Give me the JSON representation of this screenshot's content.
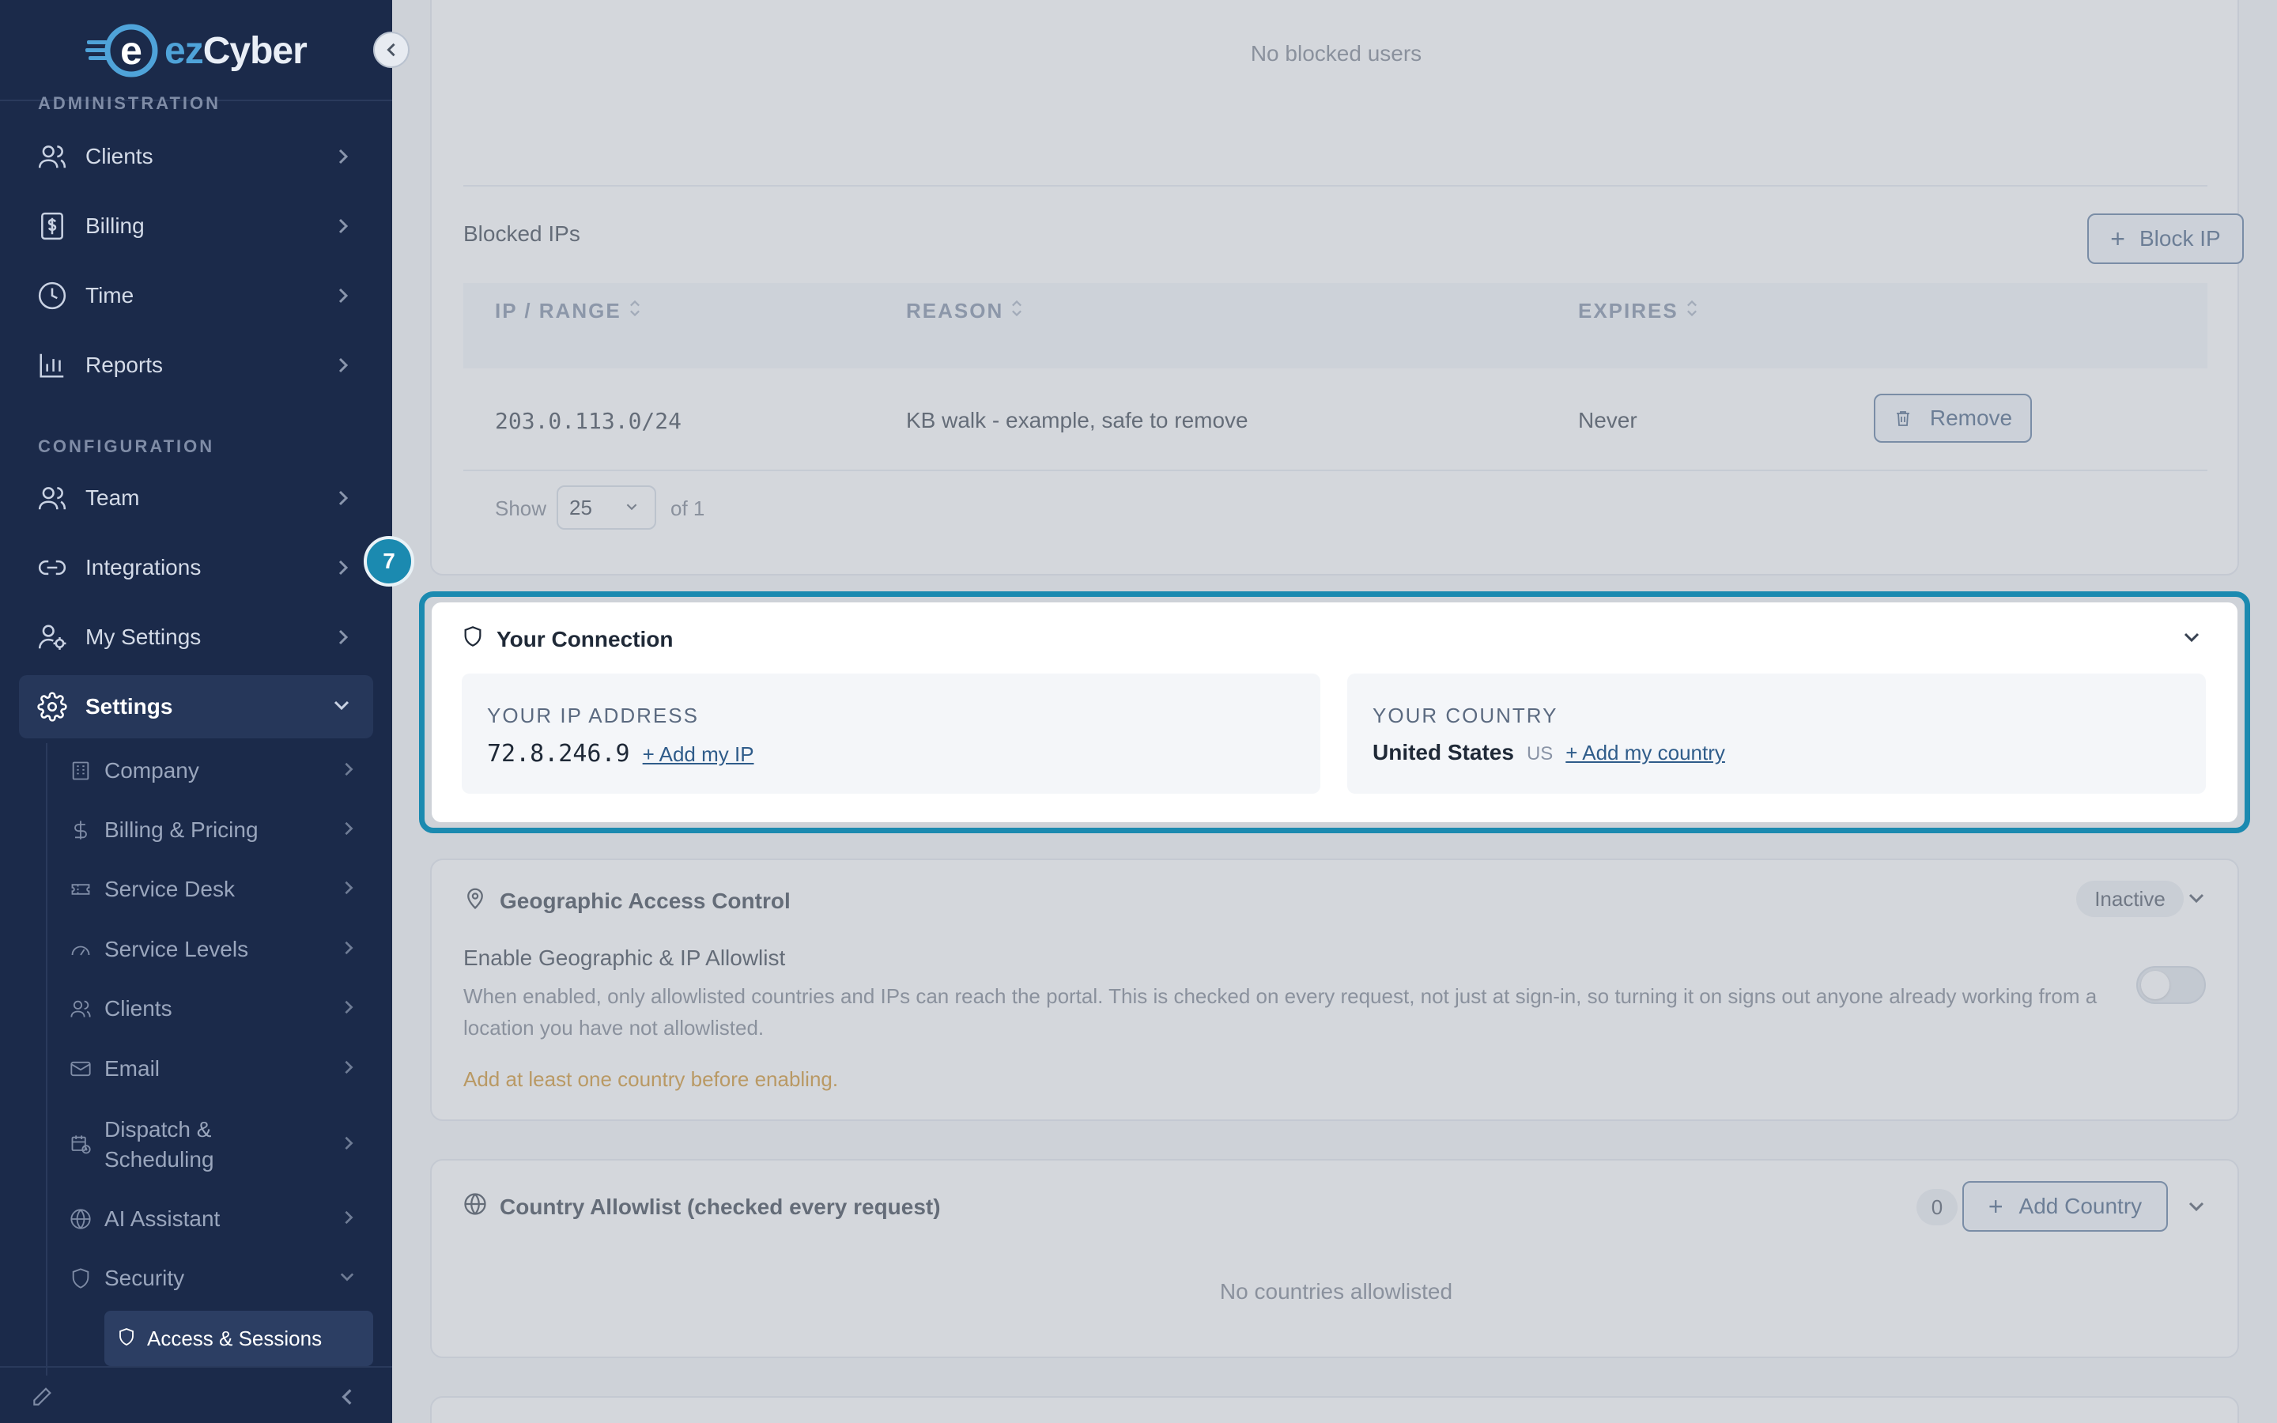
{
  "brand": {
    "name_a": "ez",
    "name_b": "Cyber",
    "accent": "#4fa3d9",
    "sidebar_bg": "#1b2a4a",
    "focus_color": "#1b8ab0"
  },
  "sidebar": {
    "section_admin": "ADMINISTRATION",
    "section_config": "CONFIGURATION",
    "admin_items": [
      {
        "label": "Clients",
        "icon": "users-icon"
      },
      {
        "label": "Billing",
        "icon": "invoice-dollar-icon"
      },
      {
        "label": "Time",
        "icon": "clock-icon"
      },
      {
        "label": "Reports",
        "icon": "bar-chart-icon"
      }
    ],
    "config_items": [
      {
        "label": "Team",
        "icon": "users-icon"
      },
      {
        "label": "Integrations",
        "icon": "link-icon"
      },
      {
        "label": "My Settings",
        "icon": "user-gear-icon"
      },
      {
        "label": "Settings",
        "icon": "gear-icon"
      }
    ],
    "settings_sub": [
      {
        "label": "Company",
        "icon": "building-icon"
      },
      {
        "label": "Billing & Pricing",
        "icon": "dollar-icon"
      },
      {
        "label": "Service Desk",
        "icon": "ticket-icon"
      },
      {
        "label": "Service Levels",
        "icon": "gauge-icon"
      },
      {
        "label": "Clients",
        "icon": "users-icon"
      },
      {
        "label": "Email",
        "icon": "mail-icon"
      },
      {
        "label": "Dispatch & Scheduling",
        "icon": "calendar-clock-icon"
      },
      {
        "label": "AI Assistant",
        "icon": "globe-brain-icon"
      },
      {
        "label": "Security",
        "icon": "shield-icon"
      }
    ],
    "security_sub": [
      {
        "label": "Access & Sessions",
        "icon": "shield-icon"
      }
    ]
  },
  "blocked_users": {
    "empty": "No blocked users"
  },
  "blocked_ips": {
    "title": "Blocked IPs",
    "add_label": "Block IP",
    "columns": [
      "IP / RANGE",
      "REASON",
      "EXPIRES"
    ],
    "rows": [
      {
        "ip": "203.0.113.0/24",
        "reason": "KB walk - example, safe to remove",
        "expires": "Never",
        "action": "Remove"
      }
    ],
    "pager": {
      "show_label": "Show",
      "page_size": "25",
      "of_label": "of 1"
    }
  },
  "tour": {
    "step": "7"
  },
  "connection": {
    "title": "Your Connection",
    "ip_caption": "YOUR IP ADDRESS",
    "ip_value": "72.8.246.9",
    "ip_link": "+ Add my IP",
    "country_caption": "YOUR COUNTRY",
    "country_value": "United States",
    "country_code": "US",
    "country_link": "+ Add my country"
  },
  "geo": {
    "title": "Geographic Access Control",
    "status": "Inactive",
    "enable_label": "Enable Geographic & IP Allowlist",
    "description_1": "When enabled, only allowlisted countries and IPs can reach the portal. This is checked on every request, not just at sign-in, so turning it on signs out anyone already working from a",
    "description_2": "location you have not allowlisted.",
    "warning": "Add at least one country before enabling.",
    "warning_color": "#c9820f",
    "toggle_on": false
  },
  "country_allowlist": {
    "title": "Country Allowlist (checked every request)",
    "count": "0",
    "add_label": "Add Country",
    "empty": "No countries allowlisted"
  }
}
